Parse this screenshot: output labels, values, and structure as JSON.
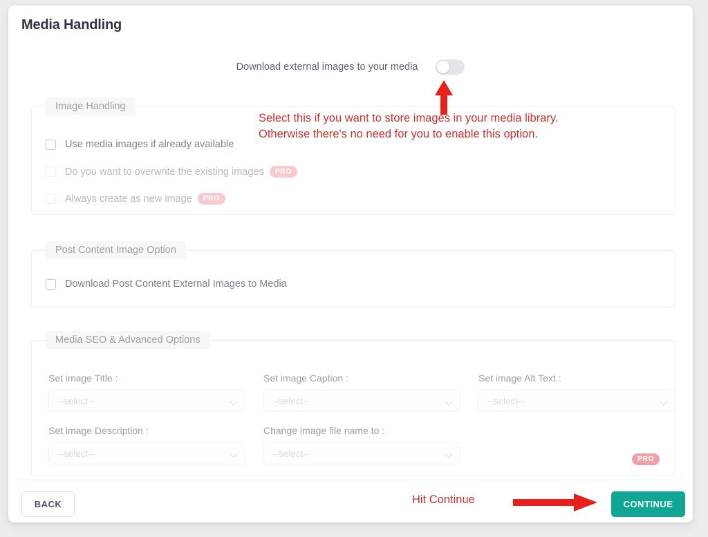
{
  "card": {
    "title": "Media Handling"
  },
  "toggle": {
    "label": "Download external images to your media",
    "state": "off"
  },
  "groups": {
    "image_handling": {
      "legend": "Image Handling",
      "options": [
        {
          "label": "Use media images if already available",
          "checked": false,
          "pro": false,
          "disabled": false
        },
        {
          "label": "Do you want to overwrite the existing images",
          "checked": false,
          "pro": true,
          "pro_label": "PRO",
          "disabled": true
        },
        {
          "label": "Always create as new image",
          "checked": false,
          "pro": true,
          "pro_label": "PRO",
          "disabled": true
        }
      ]
    },
    "post_content": {
      "legend": "Post Content Image Option",
      "options": [
        {
          "label": "Download Post Content External Images to Media",
          "checked": false,
          "pro": false,
          "disabled": false
        }
      ]
    },
    "media_seo": {
      "legend": "Media SEO & Advanced Options",
      "pro_label": "PRO",
      "fields": [
        {
          "label": "Set image Title :",
          "value": "--select--"
        },
        {
          "label": "Set image Caption :",
          "value": "--select--"
        },
        {
          "label": "Set image Alt Text :",
          "value": "--select--"
        },
        {
          "label": "Set image Description :",
          "value": "--select--"
        },
        {
          "label": "Change image file name to :",
          "value": "--select--"
        }
      ]
    }
  },
  "footer": {
    "back_label": "BACK",
    "continue_label": "CONTINUE"
  },
  "annotations": {
    "media_note": "Select this if you want to store images in your media library.\nOtherwise there's no need for you to enable this option.",
    "hit_continue": "Hit Continue"
  },
  "colors": {
    "accent_teal": "#11a596",
    "annotation_red": "#c9322d",
    "pro_pink": "#f2a0a6",
    "page_background": "#ececed",
    "card_background": "#ffffff"
  }
}
